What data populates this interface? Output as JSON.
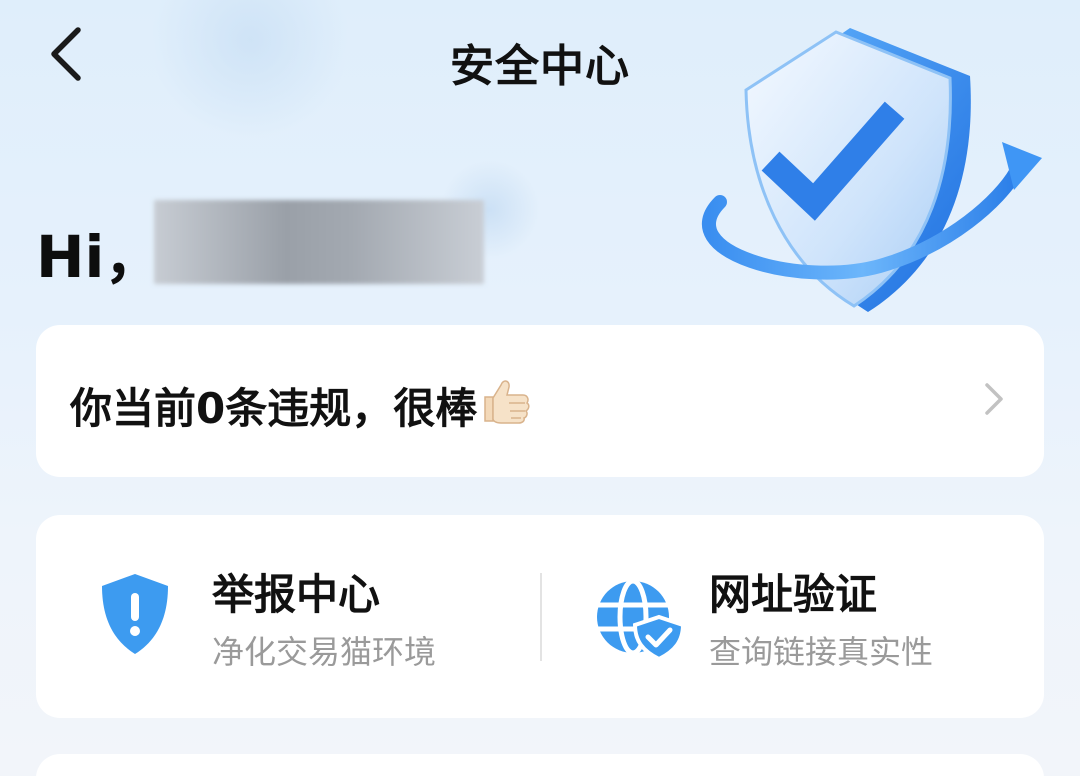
{
  "header": {
    "title": "安全中心"
  },
  "greeting": {
    "text": "Hi，"
  },
  "violation": {
    "text": "你当前0条违规，很棒",
    "emoji": "👍"
  },
  "tools": [
    {
      "title": "举报中心",
      "subtitle": "净化交易猫环境",
      "icon": "shield-exclamation-icon"
    },
    {
      "title": "网址验证",
      "subtitle": "查询链接真实性",
      "icon": "globe-check-icon"
    }
  ],
  "colors": {
    "accent": "#2f8df0",
    "icon_blue": "#3d9bf0",
    "subtitle_gray": "#9a9a9a"
  }
}
